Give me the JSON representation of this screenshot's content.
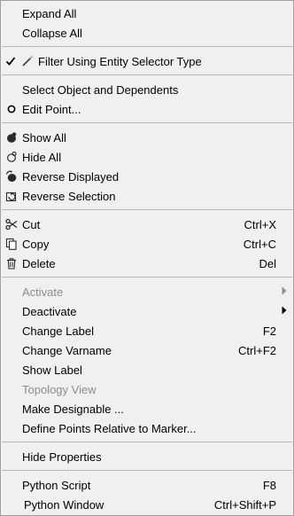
{
  "menu": {
    "expand_all": "Expand All",
    "collapse_all": "Collapse All",
    "filter_using_type": "Filter Using Entity Selector Type",
    "select_object_dependents": "Select Object and Dependents",
    "edit_point": "Edit Point...",
    "show_all": "Show All",
    "hide_all": "Hide All",
    "reverse_displayed": "Reverse Displayed",
    "reverse_selection": "Reverse Selection",
    "cut": "Cut",
    "cut_shortcut": "Ctrl+X",
    "copy": "Copy",
    "copy_shortcut": "Ctrl+C",
    "delete": "Delete",
    "delete_shortcut": "Del",
    "activate": "Activate",
    "deactivate": "Deactivate",
    "change_label": "Change Label",
    "change_label_shortcut": "F2",
    "change_varname": "Change Varname",
    "change_varname_shortcut": "Ctrl+F2",
    "show_label": "Show Label",
    "topology_view": "Topology View",
    "make_designable": "Make Designable ...",
    "define_points_relative": "Define Points Relative to Marker...",
    "hide_properties": "Hide Properties",
    "python_script": "Python Script",
    "python_script_shortcut": "F8",
    "python_window": "Python Window",
    "python_window_shortcut": "Ctrl+Shift+P"
  },
  "colors": {
    "menu_background": "#f0f0f0",
    "disabled_text": "#8c8c8c",
    "separator": "#b8b8b8"
  },
  "icons": {
    "filter_checked": "check-mark-icon",
    "filter": "filter-wand-icon",
    "edit_point": "radio-dot-icon",
    "show_all": "show-all-icon",
    "hide_all": "hide-all-icon",
    "reverse_displayed": "reverse-displayed-icon",
    "reverse_selection": "reverse-selection-icon",
    "cut": "scissors-icon",
    "copy": "copy-icon",
    "delete": "trash-icon",
    "submenu": "chevron-right-icon"
  }
}
